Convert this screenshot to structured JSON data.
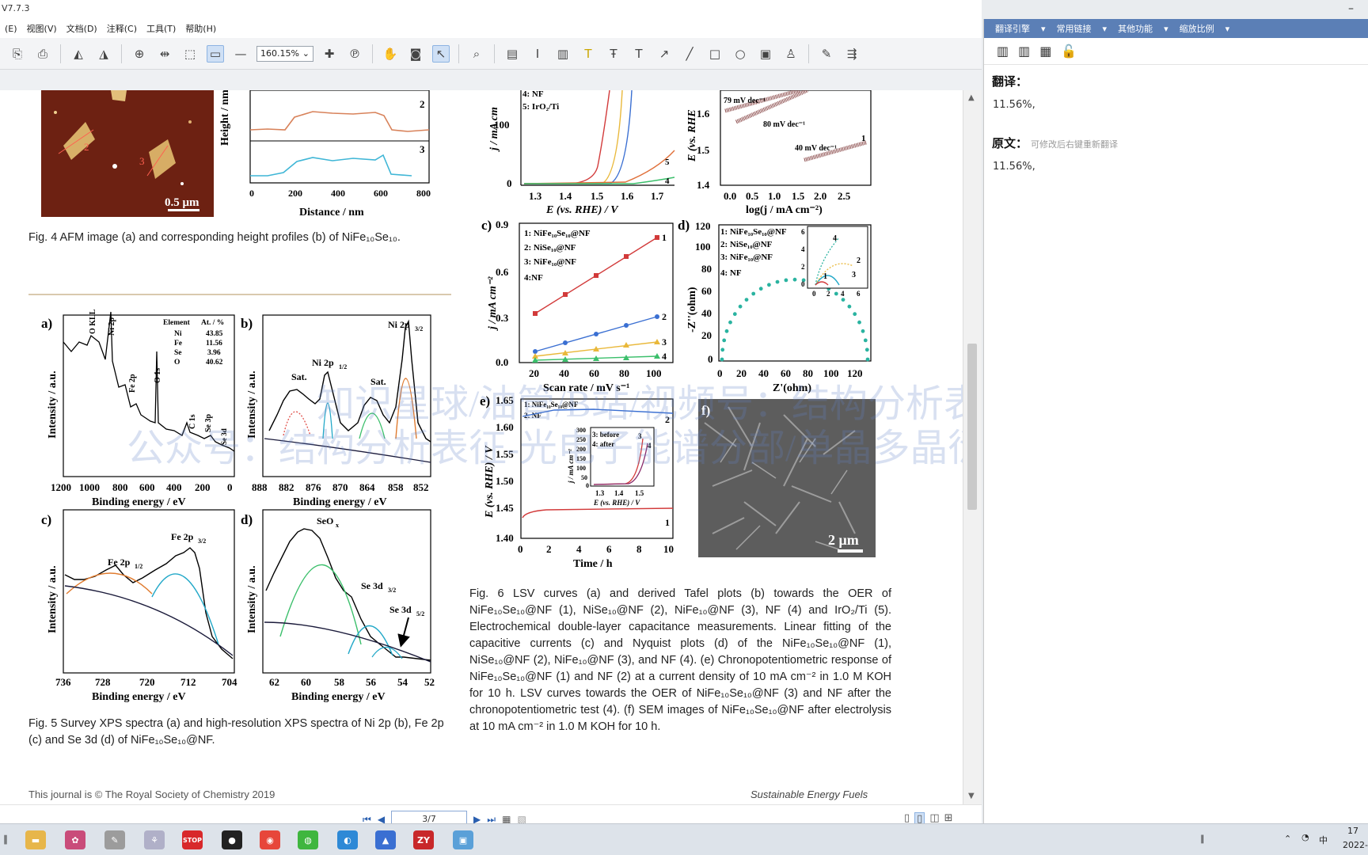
{
  "app": {
    "title": "V7.7.3"
  },
  "menu": [
    "(E)",
    "视图(V)",
    "文档(D)",
    "注释(C)",
    "工具(T)",
    "帮助(H)"
  ],
  "toolbar": {
    "zoom": "160.15%"
  },
  "document": {
    "fig4_caption": "Fig. 4  AFM image (a) and corresponding height profiles (b) of NiFe₁₀Se₁₀.",
    "fig5_caption": "Fig. 5  Survey XPS spectra (a) and high-resolution XPS spectra of Ni 2p (b), Fe 2p (c) and Se 3d (d) of NiFe₁₀Se₁₀@NF.",
    "fig6_caption": "Fig. 6  LSV curves (a) and derived Tafel plots (b) towards the OER of NiFe₁₀Se₁₀@NF (1), NiSe₁₀@NF (2), NiFe₁₀@NF (3), NF (4) and IrO₂/Ti (5). Electrochemical double-layer capacitance measurements. Linear fitting of the capacitive currents (c) and Nyquist plots (d) of the NiFe₁₀Se₁₀@NF (1), NiSe₁₀@NF (2), NiFe₁₀@NF (3), and NF (4). (e) Chronopotentiometric response of NiFe₁₀Se₁₀@NF (1) and NF (2) at a current density of 10 mA cm⁻² in 1.0 M KOH for 10 h. LSV curves towards the OER of NiFe₁₀Se₁₀@NF (3) and NF after the chronopotentiometric test (4). (f) SEM images of NiFe₁₀Se₁₀@NF after electrolysis at 10 mA cm⁻² in 1.0 M KOH for 10 h.",
    "footer_left": "This journal is © The Royal Society of Chemistry 2019",
    "footer_right": "Sustainable Energy Fuels",
    "watermark1": "知识星球/油管/B站/视频号：结构分析表征",
    "watermark2": "公众号：结构分析表征-光电子能谱分部/单晶多晶衍射分部"
  },
  "figures": {
    "fig4": {
      "scale": "0.5 μm",
      "xlabel": "Distance / nm",
      "ylabel": "Height / nm",
      "xticks": [
        "0",
        "200",
        "400",
        "600",
        "800"
      ],
      "profiles": [
        "2",
        "3"
      ]
    },
    "fig5a": {
      "panel": "a)",
      "xlabel": "Binding energy / eV",
      "ylabel": "Intensity / a.u.",
      "xticks": [
        "1200",
        "1000",
        "800",
        "600",
        "400",
        "200",
        "0"
      ],
      "peaks": [
        "O KLL",
        "Ni 2p",
        "Fe 2p",
        "O 1s",
        "C 1s",
        "Se 3p",
        "Se 3d"
      ],
      "table": {
        "header": [
          "Element",
          "At. / %"
        ],
        "rows": [
          [
            "Ni",
            "43.85"
          ],
          [
            "Fe",
            "11.56"
          ],
          [
            "Se",
            "3.96"
          ],
          [
            "O",
            "40.62"
          ]
        ]
      }
    },
    "fig5b": {
      "panel": "b)",
      "xlabel": "Binding energy / eV",
      "ylabel": "Intensity / a.u.",
      "xticks": [
        "888",
        "882",
        "876",
        "870",
        "864",
        "858",
        "852"
      ],
      "labels": [
        "Ni 2p",
        "3/2",
        "Ni 2p",
        "1/2",
        "Sat.",
        "Sat."
      ]
    },
    "fig5c": {
      "panel": "c)",
      "xlabel": "Binding energy / eV",
      "ylabel": "Intensity / a.u.",
      "xticks": [
        "736",
        "728",
        "720",
        "712",
        "704"
      ],
      "labels": [
        "Fe 2p",
        "3/2",
        "Fe 2p",
        "1/2"
      ]
    },
    "fig5d": {
      "panel": "d)",
      "xlabel": "Binding energy / eV",
      "ylabel": "Intensity / a.u.",
      "xticks": [
        "62",
        "60",
        "58",
        "56",
        "54",
        "52"
      ],
      "labels": [
        "SeO",
        "x",
        "Se 3d",
        "3/2",
        "Se 3d",
        "5/2"
      ]
    },
    "fig6a": {
      "ylabel": "j / mA cm",
      "xlabel": "E (vs. RHE) / V",
      "xticks": [
        "1.3",
        "1.4",
        "1.5",
        "1.6",
        "1.7"
      ],
      "yticks": [
        "100",
        "0"
      ],
      "legend": [
        "4: NF",
        "5: IrO₂/Ti"
      ],
      "curvelabels": [
        "5",
        "4"
      ]
    },
    "fig6b": {
      "ylabel": "E (vs. RHE",
      "xlabel": "log(j / mA cm⁻²)",
      "xticks": [
        "0.0",
        "0.5",
        "1.0",
        "1.5",
        "2.0",
        "2.5"
      ],
      "yticks": [
        "1.6",
        "1.5",
        "1.4"
      ],
      "slopes": [
        "79 mV dec⁻¹",
        "80 mV dec⁻¹",
        "40 mV dec⁻¹"
      ],
      "curvelabels": [
        "1"
      ]
    },
    "fig6c": {
      "panel": "c)",
      "ylabel": "j / mA cm⁻²",
      "xlabel": "Scan rate / mV s⁻¹",
      "xticks": [
        "20",
        "40",
        "60",
        "80",
        "100"
      ],
      "yticks": [
        "0.9",
        "0.6",
        "0.3",
        "0.0"
      ],
      "legend": [
        "1: NiFe₁₀Se₁₀@NF",
        "2: NiSe₁₀@NF",
        "3: NiFe₁₀@NF",
        "4:NF"
      ],
      "curvelabels": [
        "1",
        "2",
        "3",
        "4"
      ]
    },
    "fig6d": {
      "panel": "d)",
      "ylabel": "-Z''(ohm)",
      "xlabel": "Z'(ohm)",
      "xticks": [
        "0",
        "20",
        "40",
        "60",
        "80",
        "100",
        "120"
      ],
      "yticks": [
        "120",
        "100",
        "80",
        "60",
        "40",
        "20",
        "0"
      ],
      "legend": [
        "1: NiFe₁₀Se₁₀@NF",
        "2: NiSe₁₀@NF",
        "3: NiFe₁₀@NF",
        "4: NF"
      ],
      "inset_xticks": [
        "0",
        "2",
        "4",
        "6"
      ],
      "inset_yticks": [
        "6",
        "4",
        "2",
        "0"
      ],
      "inset_labels": [
        "4",
        "2",
        "3",
        "1"
      ]
    },
    "fig6e": {
      "panel": "e)",
      "ylabel": "E (vs. RHE) / V",
      "xlabel": "Time / h",
      "xticks": [
        "0",
        "2",
        "4",
        "6",
        "8",
        "10"
      ],
      "yticks": [
        "1.65",
        "1.60",
        "1.55",
        "1.50",
        "1.45",
        "1.40"
      ],
      "legend": [
        "1: NiFe₁₀Se₁₀@NF",
        "2: NF"
      ],
      "curvelabels": [
        "2",
        "1"
      ],
      "inset": {
        "legend": [
          "3: before",
          "4: after"
        ],
        "ylabel": "j / mA cm⁻²",
        "xlabel": "E (vs. RHE) / V",
        "xticks": [
          "1.3",
          "1.4",
          "1.5"
        ],
        "yticks": [
          "300",
          "250",
          "200",
          "150",
          "100",
          "50",
          "0"
        ],
        "curvelabels": [
          "3",
          "4"
        ]
      }
    },
    "fig6f": {
      "panel": "f)",
      "scale": "2 μm"
    }
  },
  "pager": {
    "page": "3/7"
  },
  "right_pane": {
    "tabs": [
      "翻译引擎",
      "常用链接",
      "其他功能",
      "缩放比例"
    ],
    "translation_label": "翻译：",
    "translation_text": "11.56%,",
    "original_label": "原文：",
    "original_hint": "可修改后右键重新翻译",
    "original_text": "11.56%,"
  },
  "taskbar": {
    "clock_time": "17",
    "clock_date": "2022-"
  }
}
